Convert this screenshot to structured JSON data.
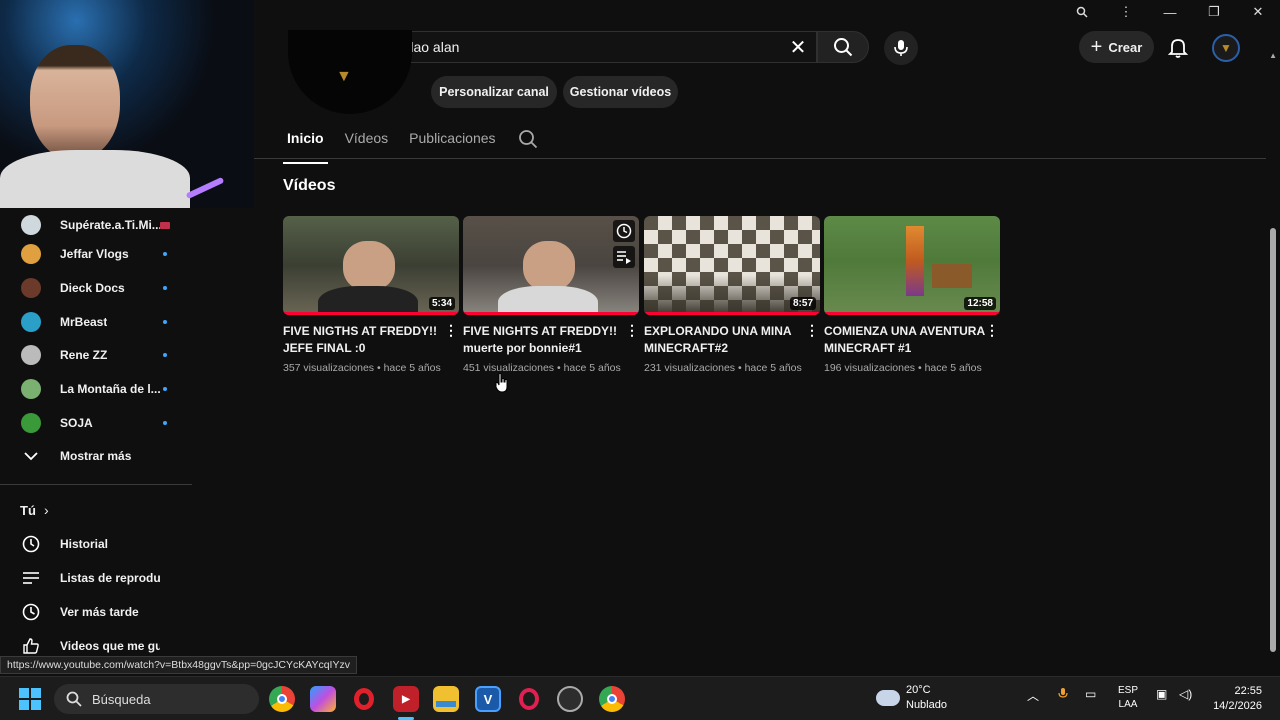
{
  "window": {
    "minimize": "—",
    "maximize": "❐",
    "close": "✕"
  },
  "topbar": {
    "search_query": "el pelao alan",
    "create_label": "Crear",
    "search_zoom_icon": "magnifier",
    "more_icon": "⋮"
  },
  "channel": {
    "customize_label": "Personalizar canal",
    "manage_label": "Gestionar vídeos",
    "tabs": [
      {
        "label": "Inicio",
        "active": true
      },
      {
        "label": "Vídeos",
        "active": false
      },
      {
        "label": "Publicaciones",
        "active": false
      }
    ],
    "section_title": "Vídeos"
  },
  "videos": [
    {
      "title_line1": "FIVE NIGTHS AT FREDDY!!",
      "title_line2": "JEFE FINAL :0",
      "duration": "5:34",
      "meta": "357 visualizaciones • hace 5 años",
      "bg": "#3b3f33"
    },
    {
      "title_line1": "FIVE NIGHTS AT FREDDY!!",
      "title_line2": "muerte por bonnie#1",
      "duration": "",
      "meta": "451 visualizaciones • hace 5 años",
      "bg": "#4a4540"
    },
    {
      "title_line1": "EXPLORANDO UNA MINA",
      "title_line2": "MINECRAFT#2",
      "duration": "8:57",
      "meta": "231 visualizaciones • hace 5 años",
      "bg": "#7d7564"
    },
    {
      "title_line1": "COMIENZA UNA AVENTURA",
      "title_line2": "MINECRAFT #1",
      "duration": "12:58",
      "meta": "196 visualizaciones • hace 5 años",
      "bg": "#4f7a3a"
    }
  ],
  "sidebar": {
    "subscriptions": [
      {
        "name": "Supérate.a.Ti.Mi...",
        "color": "#cfd8dc",
        "dot": false
      },
      {
        "name": "Jeffar Vlogs",
        "color": "#e0a040",
        "dot": true
      },
      {
        "name": "Dieck Docs",
        "color": "#6b3a2a",
        "dot": true
      },
      {
        "name": "MrBeast",
        "color": "#2aa0c8",
        "dot": true
      },
      {
        "name": "Rene ZZ",
        "color": "#bbbbbb",
        "dot": true
      },
      {
        "name": "La Montaña de l...",
        "color": "#7ab070",
        "dot": true
      },
      {
        "name": "SOJA",
        "color": "#3a9a3a",
        "dot": true
      }
    ],
    "show_more": "Mostrar más",
    "you_label": "Tú",
    "you_items": [
      "Historial",
      "Listas de reproducc...",
      "Ver más tarde",
      "Videos que me gus..."
    ]
  },
  "status_url": "https://www.youtube.com/watch?v=Btbx48ggvTs&pp=0gcJCYcKAYcqIYzv",
  "taskbar": {
    "search_placeholder": "Búsqueda",
    "weather_temp": "20°C",
    "weather_desc": "Nublado",
    "lang_line1": "ESP",
    "lang_line2": "LAA",
    "time": "22:55",
    "date": "14/2/2026"
  }
}
